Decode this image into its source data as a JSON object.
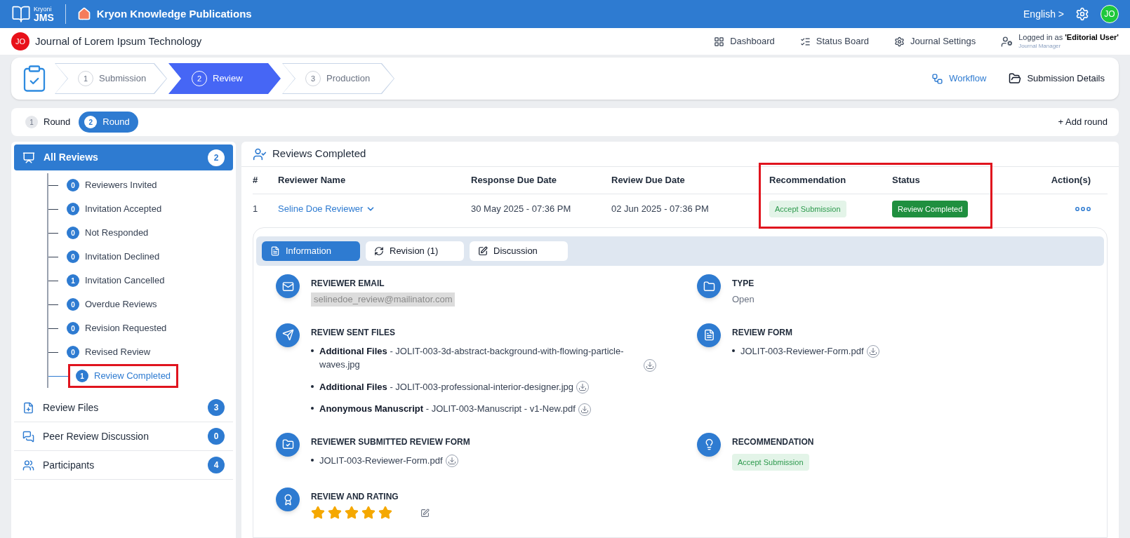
{
  "top_bar": {
    "logo_small": "Kryoni",
    "logo": "JMS",
    "publisher": "Kryon Knowledge Publications",
    "language": "English >",
    "avatar": "JO"
  },
  "journal_bar": {
    "badge": "JO",
    "title": "Journal of Lorem Ipsum Technology",
    "nav": [
      "Dashboard",
      "Status Board",
      "Journal Settings"
    ],
    "user_prefix": "Logged in as ",
    "user": "'Editorial User'",
    "role": "Journal Manager"
  },
  "stepper": {
    "steps": [
      {
        "number": "1",
        "label": "Submission",
        "selected": false
      },
      {
        "number": "2",
        "label": "Review",
        "selected": true
      },
      {
        "number": "3",
        "label": "Production",
        "selected": false
      }
    ],
    "links": [
      "Workflow",
      "Submission Details"
    ]
  },
  "rounds": {
    "items": [
      {
        "number": "1",
        "label": "Round",
        "selected": false
      },
      {
        "number": "2",
        "label": "Round",
        "selected": true
      }
    ],
    "add": "+ Add round"
  },
  "sidebar": {
    "header": {
      "label": "All Reviews",
      "count": "2",
      "selected": true
    },
    "children": [
      {
        "label": "Reviewers Invited",
        "count": "0",
        "selected": false,
        "highlighted": false
      },
      {
        "label": "Invitation Accepted",
        "count": "0",
        "selected": false,
        "highlighted": false
      },
      {
        "label": "Not Responded",
        "count": "0",
        "selected": false,
        "highlighted": false
      },
      {
        "label": "Invitation Declined",
        "count": "0",
        "selected": false,
        "highlighted": false
      },
      {
        "label": "Invitation Cancelled",
        "count": "1",
        "selected": false,
        "highlighted": false
      },
      {
        "label": "Overdue Reviews",
        "count": "0",
        "selected": false,
        "highlighted": false
      },
      {
        "label": "Revision Requested",
        "count": "0",
        "selected": false,
        "highlighted": false
      },
      {
        "label": "Revised Review",
        "count": "0",
        "selected": false,
        "highlighted": false
      },
      {
        "label": "Review Completed",
        "count": "1",
        "selected": true,
        "highlighted": true
      }
    ],
    "items": [
      {
        "label": "Review Files",
        "count": "3"
      },
      {
        "label": "Peer Review Discussion",
        "count": "0"
      },
      {
        "label": "Participants",
        "count": "4"
      }
    ]
  },
  "panel": {
    "title": "Reviews Completed",
    "table": {
      "columns": [
        {
          "label": "#",
          "highlighted": false
        },
        {
          "label": "Reviewer Name",
          "highlighted": false
        },
        {
          "label": "Response Due Date",
          "highlighted": false
        },
        {
          "label": "Review Due Date",
          "highlighted": false
        },
        {
          "label": "Recommendation",
          "highlighted": true
        },
        {
          "label": "Status",
          "highlighted": true
        },
        {
          "label": "Action(s)",
          "highlighted": false
        }
      ],
      "rows": [
        {
          "cells": [
            {
              "kind": "text",
              "text": "1"
            },
            {
              "kind": "link",
              "text": "Seline Doe Reviewer"
            },
            {
              "kind": "text",
              "text": "30 May 2025 - 07:36 PM"
            },
            {
              "kind": "text",
              "text": "02 Jun 2025 - 07:36 PM"
            },
            {
              "kind": "tag",
              "text": "Accept Submission"
            },
            {
              "kind": "status",
              "text": "Review Completed"
            },
            {
              "kind": "actions"
            }
          ]
        }
      ]
    },
    "tabs": [
      {
        "label": "Information",
        "selected": true
      },
      {
        "label": "Revision (1)",
        "selected": false
      },
      {
        "label": "Discussion",
        "selected": false
      }
    ],
    "sections": [
      {
        "kind": "email",
        "title": "REVIEWER EMAIL",
        "value": "selinedoe_review@mailinator.com"
      },
      {
        "kind": "text",
        "title": "TYPE",
        "value": "Open"
      },
      {
        "kind": "files",
        "title": "REVIEW SENT FILES",
        "files": [
          {
            "label": "Additional Files",
            "name": " - JOLIT-003-3d-abstract-background-with-flowing-particle-waves.jpg"
          },
          {
            "label": "Additional Files",
            "name": " - JOLIT-003-professional-interior-designer.jpg"
          },
          {
            "label": "Anonymous Manuscript",
            "name": " - JOLIT-003-Manuscript - v1-New.pdf"
          }
        ]
      },
      {
        "kind": "files",
        "title": "REVIEW FORM",
        "files": [
          {
            "name": "JOLIT-003-Reviewer-Form.pdf"
          }
        ]
      },
      {
        "kind": "files",
        "title": "REVIEWER SUBMITTED REVIEW FORM",
        "files": [
          {
            "name": "JOLIT-003-Reviewer-Form.pdf"
          }
        ]
      },
      {
        "kind": "tag",
        "title": "RECOMMENDATION",
        "value": "Accept Submission"
      },
      {
        "kind": "rating",
        "title": "REVIEW AND RATING",
        "stars": 5
      }
    ]
  }
}
